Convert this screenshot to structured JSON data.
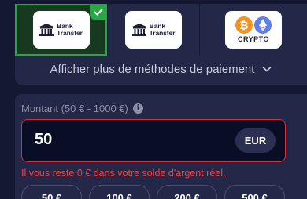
{
  "payment_methods": [
    {
      "line1": "Bank",
      "line2": "Transfer",
      "icon": "bank-icon",
      "selected": true
    },
    {
      "line1": "Bank",
      "line2": "Transfer",
      "icon": "bank-icon",
      "selected": false
    },
    {
      "label": "CRYPTO",
      "icons": [
        "bitcoin-icon",
        "ethereum-icon"
      ],
      "selected": false
    }
  ],
  "more_methods_label": "Afficher plus de méthodes de paiement",
  "amount": {
    "label": "Montant (50 € - 1000 €)",
    "value": "50",
    "currency": "EUR"
  },
  "error_message": "Il vous reste 0 € dans votre solde d'argent réel.",
  "quick_amounts": [
    "50 €",
    "100 €",
    "200 €",
    "500 €"
  ],
  "colors": {
    "background": "#141833",
    "panel": "#232849",
    "selected_border": "#28a745",
    "error": "#ff3b3b",
    "input_border": "#d6303a"
  }
}
